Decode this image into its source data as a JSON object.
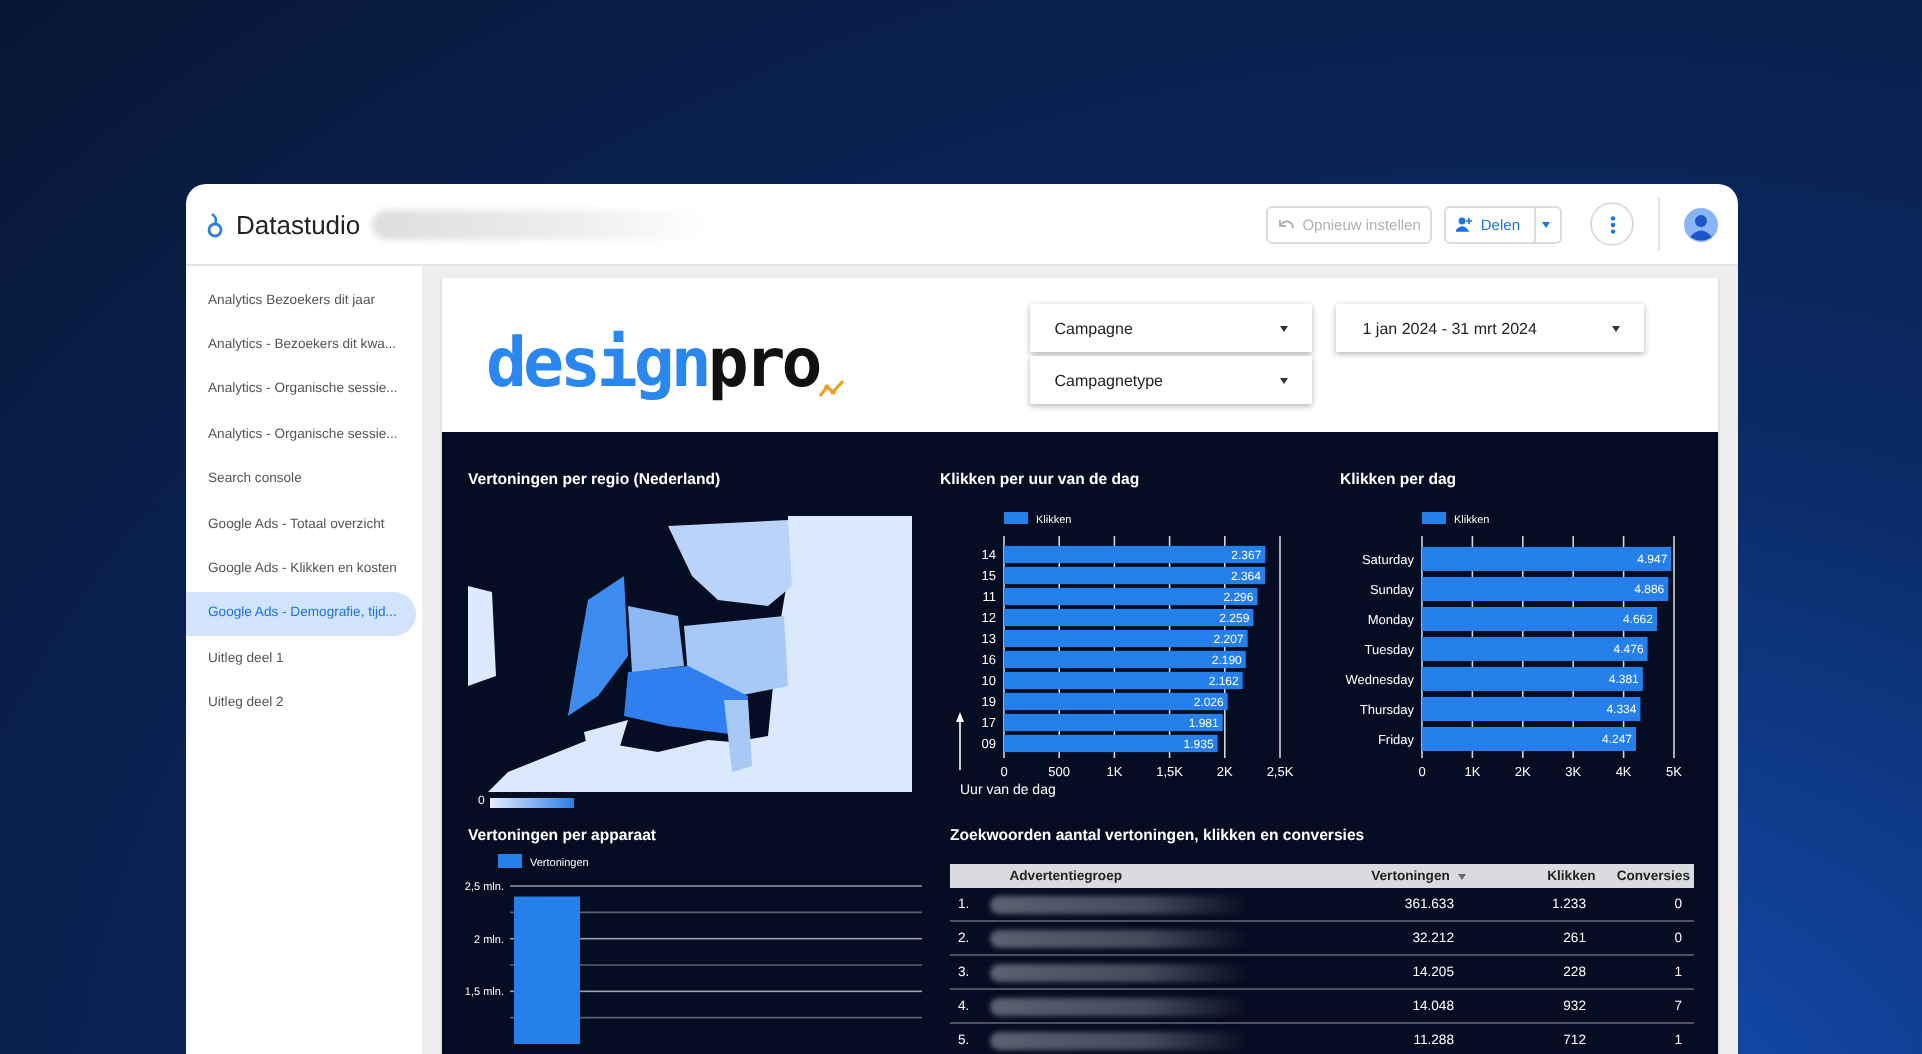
{
  "header": {
    "app_name": "Datastudio",
    "buttons": [
      {
        "kind": "reset",
        "label": "Opnieuw instellen",
        "disabled": true
      },
      {
        "kind": "share",
        "label": "Delen",
        "disabled": false
      }
    ]
  },
  "sidebar": {
    "items": [
      {
        "label": "Analytics Bezoekers dit jaar",
        "selected": false
      },
      {
        "label": "Analytics - Bezoekers dit kwa...",
        "selected": false
      },
      {
        "label": "Analytics - Organische sessie...",
        "selected": false
      },
      {
        "label": "Analytics - Organische sessie...",
        "selected": false
      },
      {
        "label": "Search console",
        "selected": false
      },
      {
        "label": "Google Ads - Totaal overzicht",
        "selected": false
      },
      {
        "label": "Google Ads - Klikken en kosten",
        "selected": false
      },
      {
        "label": "Google Ads - Demografie, tijd...",
        "selected": true
      },
      {
        "label": "Uitleg deel 1",
        "selected": false
      },
      {
        "label": "Uitleg deel 2",
        "selected": false
      }
    ]
  },
  "report": {
    "logo": [
      "design",
      "pro"
    ],
    "filters": [
      {
        "label": "Campagne"
      },
      {
        "label": "Campagnetype"
      }
    ],
    "date_range": {
      "label": "1 jan 2024 - 31 mrt 2024"
    },
    "map": {
      "title": "Vertoningen per regio (Nederland)",
      "legend_min": "0"
    },
    "hour_chart": {
      "title": "Klikken per uur van de dag",
      "chart_data": {
        "type": "bar",
        "orientation": "horizontal",
        "xlabel": "Uur van de dag",
        "categories": [
          "14",
          "15",
          "11",
          "12",
          "13",
          "16",
          "10",
          "19",
          "17",
          "09"
        ],
        "series": [
          {
            "name": "Klikken",
            "color": "#2680eb",
            "values": [
              2367,
              2364,
              2296,
              2259,
              2207,
              2190,
              2162,
              2026,
              1981,
              1935
            ]
          }
        ],
        "xlim": [
          0,
          2500
        ],
        "xticks": [
          {
            "value": 0,
            "label": "0"
          },
          {
            "value": 500,
            "label": "500"
          },
          {
            "value": 1000,
            "label": "1K"
          },
          {
            "value": 1500,
            "label": "1,5K"
          },
          {
            "value": 2000,
            "label": "2K"
          },
          {
            "value": 2500,
            "label": "2,5K"
          }
        ],
        "grid": true,
        "value_labels": [
          "2.367",
          "2.364",
          "2.296",
          "2.259",
          "2.207",
          "2.190",
          "2.162",
          "2.026",
          "1.981",
          "1.935"
        ]
      }
    },
    "day_chart": {
      "title": "Klikken per dag",
      "chart_data": {
        "type": "bar",
        "orientation": "horizontal",
        "categories": [
          "Saturday",
          "Sunday",
          "Monday",
          "Tuesday",
          "Wednesday",
          "Thursday",
          "Friday"
        ],
        "series": [
          {
            "name": "Klikken",
            "color": "#2680eb",
            "values": [
              4947,
              4886,
              4662,
              4476,
              4381,
              4334,
              4247
            ]
          }
        ],
        "xlim": [
          0,
          5000
        ],
        "xticks": [
          {
            "value": 0,
            "label": "0"
          },
          {
            "value": 1000,
            "label": "1K"
          },
          {
            "value": 2000,
            "label": "2K"
          },
          {
            "value": 3000,
            "label": "3K"
          },
          {
            "value": 4000,
            "label": "4K"
          },
          {
            "value": 5000,
            "label": "5K"
          }
        ],
        "grid": true,
        "value_labels": [
          "4.947",
          "4.886",
          "4.662",
          "4.476",
          "4.381",
          "4.334",
          "4.247"
        ]
      }
    },
    "device_chart": {
      "title": "Vertoningen per apparaat",
      "chart_data": {
        "type": "bar",
        "orientation": "vertical",
        "series": [
          {
            "name": "Vertoningen",
            "color": "#2680eb",
            "values": [
              2.4
            ]
          }
        ],
        "ylim": [
          1,
          2.5
        ],
        "yticks": [
          {
            "value": 1.5,
            "label": "1,5 mln."
          },
          {
            "value": 2,
            "label": "2 mln."
          },
          {
            "value": 2.5,
            "label": "2,5 mln."
          }
        ],
        "grid": true
      }
    },
    "table": {
      "title": "Zoekwoorden aantal vertoningen, klikken en conversies",
      "columns": [
        {
          "label": "Advertentiegroep",
          "sorted": false
        },
        {
          "label": "Vertoningen",
          "sorted": true
        },
        {
          "label": "Klikken",
          "sorted": false
        },
        {
          "label": "Conversies",
          "sorted": false
        }
      ],
      "rows": [
        {
          "rank": "1.",
          "vertoningen": "361.633",
          "klikken": "1.233",
          "conversies": "0"
        },
        {
          "rank": "2.",
          "vertoningen": "32.212",
          "klikken": "261",
          "conversies": "0"
        },
        {
          "rank": "3.",
          "vertoningen": "14.205",
          "klikken": "228",
          "conversies": "1"
        },
        {
          "rank": "4.",
          "vertoningen": "14.048",
          "klikken": "932",
          "conversies": "7"
        },
        {
          "rank": "5.",
          "vertoningen": "11.288",
          "klikken": "712",
          "conversies": "1"
        }
      ]
    }
  }
}
